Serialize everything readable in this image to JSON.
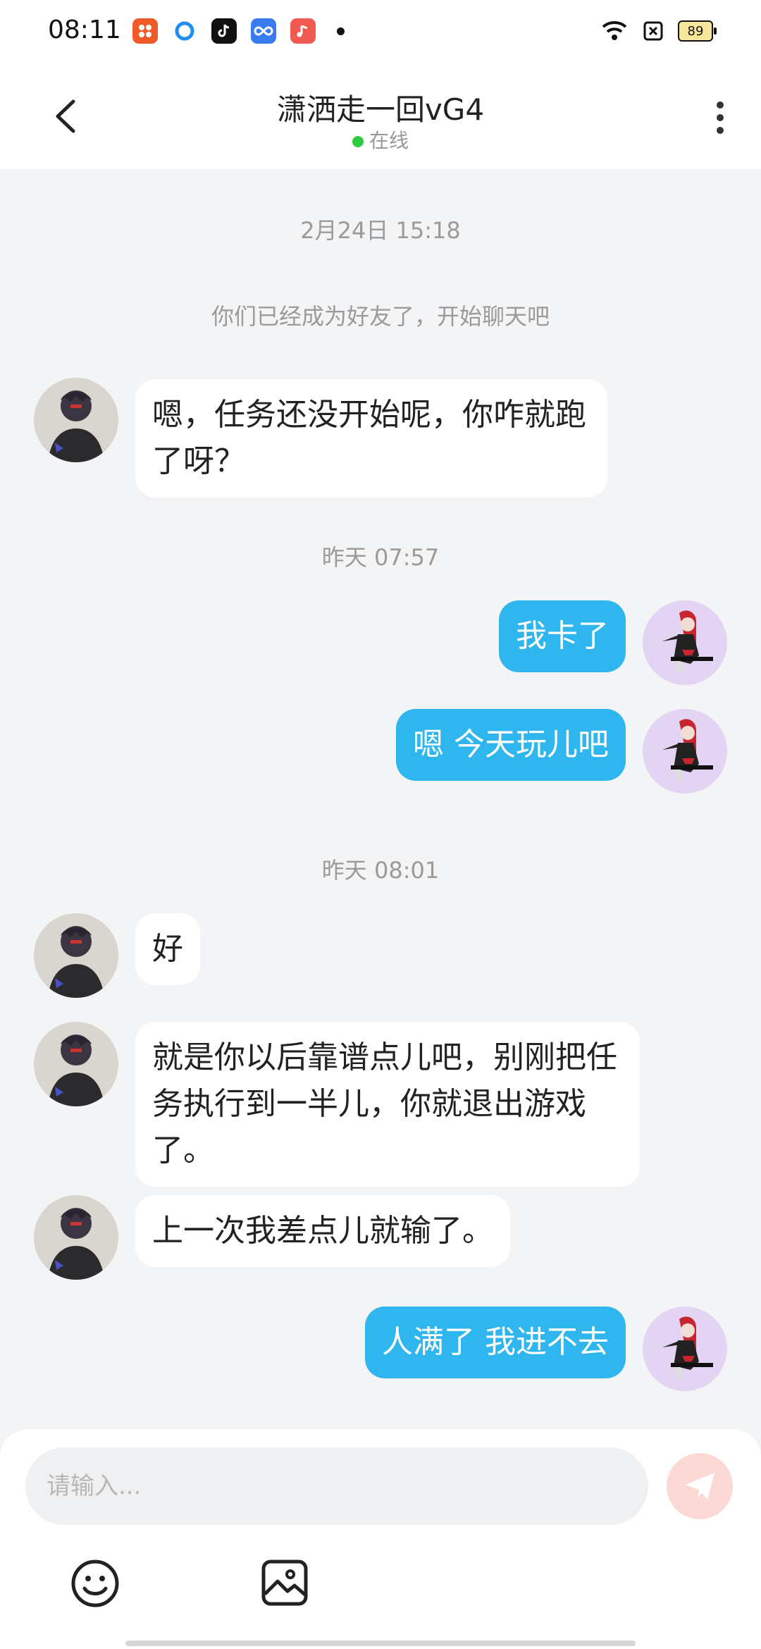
{
  "status_bar": {
    "time": "08:11",
    "battery": "89",
    "apps": [
      "douyin-lite-icon",
      "browser-icon",
      "tiktok-icon",
      "infinity-icon",
      "music-icon"
    ]
  },
  "header": {
    "title": "潇洒走一回vG4",
    "status": "在线",
    "status_color": "#2ecc40"
  },
  "messages": [
    {
      "type": "time",
      "text": "2月24日 15:18"
    },
    {
      "type": "system",
      "text": "你们已经成为好友了，开始聊天吧"
    },
    {
      "type": "in",
      "text": "嗯，任务还没开始呢，你咋就跑了呀？"
    },
    {
      "type": "time",
      "text": "昨天 07:57"
    },
    {
      "type": "out",
      "text": "我卡了"
    },
    {
      "type": "out",
      "text": "嗯 今天玩儿吧"
    },
    {
      "type": "time",
      "text": "昨天 08:01"
    },
    {
      "type": "in",
      "text": "好"
    },
    {
      "type": "in",
      "text": "就是你以后靠谱点儿吧，别刚把任务执行到一半儿，你就退出游戏了。"
    },
    {
      "type": "in",
      "text": "上一次我差点儿就输了。"
    },
    {
      "type": "out",
      "text": "人满了 我进不去"
    }
  ],
  "composer": {
    "placeholder": "请输入..."
  },
  "colors": {
    "out_bubble": "#2fb6ef",
    "in_bubble": "#ffffff",
    "send_button": "#fcd9d4"
  }
}
